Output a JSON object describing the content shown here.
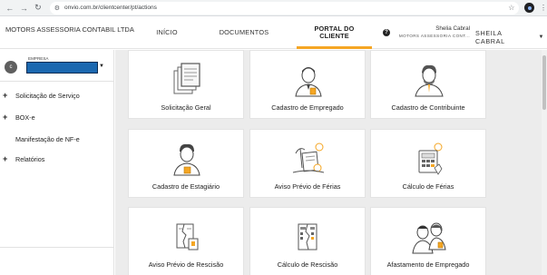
{
  "browser": {
    "url": "onvio.com.br/clientcenter/pt/actions",
    "back_icon": "arrow-left-icon",
    "forward_icon": "arrow-right-icon",
    "reload_icon": "reload-icon"
  },
  "header": {
    "company_title": "MOTORS ASSESSORIA CONTABIL LTDA",
    "nav": {
      "inicio": "INÍCIO",
      "documentos": "DOCUMENTOS",
      "portal": "PORTAL DO CLIENTE"
    },
    "user_name": "Shelia Cabral",
    "user_company": "MOTORS ASSESSORIA CONT...",
    "user_menu_label": "SHEILA CABRAL",
    "accent_color": "#f5a623"
  },
  "sidebar": {
    "avatar_initial": "c",
    "empresa_label": "EMPRESA",
    "items": [
      {
        "label": "Solicitação de Serviço",
        "expandable": true
      },
      {
        "label": "BOX-e",
        "expandable": true
      },
      {
        "label": "Manifestação de NF-e",
        "expandable": false
      },
      {
        "label": "Relatórios",
        "expandable": true
      }
    ]
  },
  "cards": [
    {
      "label": "Solicitação Geral",
      "icon": "documents-icon"
    },
    {
      "label": "Cadastro de Empregado",
      "icon": "employee-icon"
    },
    {
      "label": "Cadastro de Contribuinte",
      "icon": "contributor-icon"
    },
    {
      "label": "Cadastro de Estagiário",
      "icon": "intern-icon"
    },
    {
      "label": "Aviso Prévio de Férias",
      "icon": "vacation-notice-icon"
    },
    {
      "label": "Cálculo de Férias",
      "icon": "calculator-icon"
    },
    {
      "label": "Aviso Prévio de Rescisão",
      "icon": "termination-notice-icon"
    },
    {
      "label": "Cálculo de Rescisão",
      "icon": "termination-calculation-icon"
    },
    {
      "label": "Afastamento de Empregado",
      "icon": "employee-leave-icon"
    }
  ]
}
